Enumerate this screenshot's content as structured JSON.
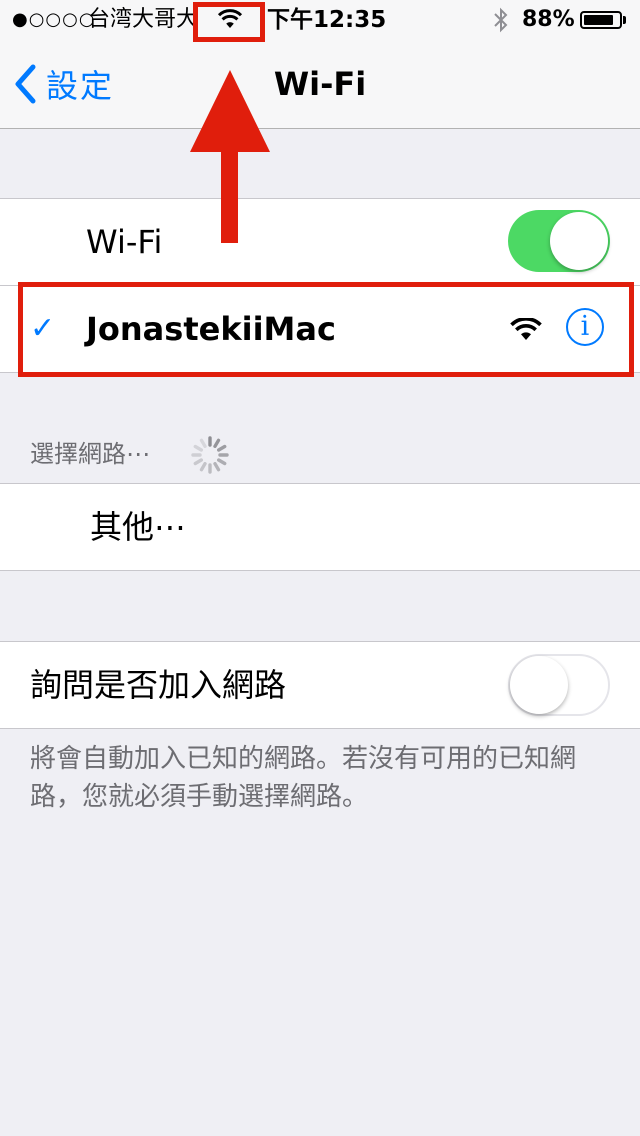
{
  "status_bar": {
    "signal": "●○○○○",
    "carrier": "台湾大哥大",
    "time": "下午12:35",
    "battery_percent": "88%",
    "battery_level": 0.88
  },
  "nav": {
    "back_label": "設定",
    "title": "Wi-Fi"
  },
  "wifi_toggle": {
    "label": "Wi-Fi",
    "state": "on"
  },
  "connected_network": {
    "name": "JonastekiiMac",
    "checkmark": "✓",
    "info_icon": "i"
  },
  "choose_network": {
    "header": "選擇網路⋯",
    "other_label": "其他⋯"
  },
  "ask_to_join": {
    "label": "詢問是否加入網路",
    "state": "off",
    "footer": "將會自動加入已知的網路。若沒有可用的已知網路，您就必須手動選擇網路。"
  },
  "colors": {
    "accent": "#007aff",
    "toggle_on": "#4cd964",
    "annotation": "#e01e0c"
  },
  "icons": [
    "wifi-icon",
    "bluetooth-icon",
    "battery-icon",
    "chevron-left-icon",
    "checkmark-icon",
    "info-icon",
    "spinner-icon"
  ]
}
